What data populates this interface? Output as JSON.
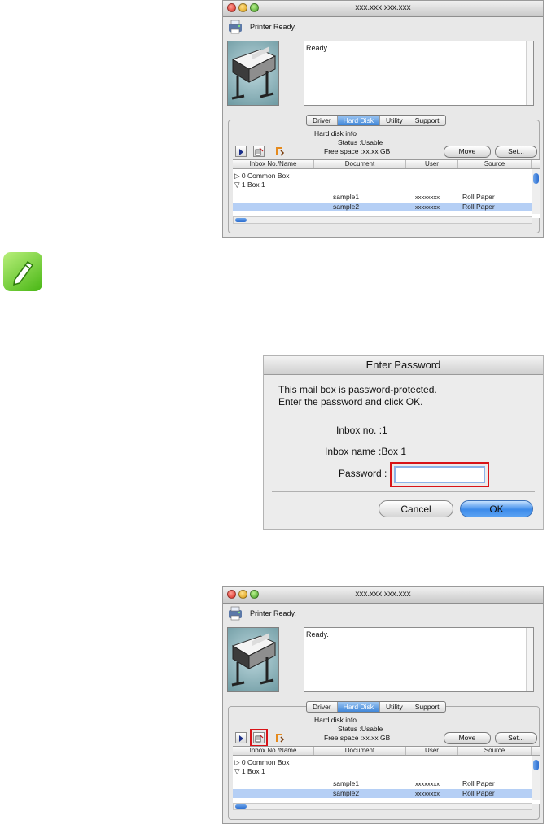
{
  "window_top": {
    "title": "xxx.xxx.xxx.xxx",
    "status": "Printer Ready.",
    "message": "Ready.",
    "tabs": [
      "Driver",
      "Hard Disk",
      "Utility",
      "Support"
    ],
    "active_tab": "Hard Disk",
    "hd_info": {
      "title": "Hard disk info",
      "status": "Status :Usable",
      "free": "Free space :xx.xx GB"
    },
    "buttons": {
      "move": "Move",
      "set": "Set..."
    },
    "columns": [
      "Inbox No./Name",
      "Document",
      "User",
      "Source"
    ],
    "rows": [
      {
        "name": "▷ 0 Common Box",
        "doc": "",
        "user": "",
        "source": ""
      },
      {
        "name": "▽ 1 Box 1",
        "doc": "",
        "user": "",
        "source": ""
      },
      {
        "name": "",
        "doc": "sample1",
        "user": "xxxxxxxx",
        "source": "Roll Paper"
      },
      {
        "name": "",
        "doc": "sample2",
        "user": "xxxxxxxx",
        "source": "Roll Paper"
      }
    ]
  },
  "dialog": {
    "title": "Enter Password",
    "line1": "This mail box is password-protected.",
    "line2": "Enter the password and click OK.",
    "inbox_no": "Inbox no. :1",
    "inbox_name": "Inbox name :Box 1",
    "password_label": "Password :",
    "password_value": "",
    "cancel": "Cancel",
    "ok": "OK"
  },
  "window_bottom": {
    "title": "xxx.xxx.xxx.xxx",
    "status": "Printer Ready.",
    "message": "Ready.",
    "tabs": [
      "Driver",
      "Hard Disk",
      "Utility",
      "Support"
    ],
    "active_tab": "Hard Disk",
    "hd_info": {
      "title": "Hard disk info",
      "status": "Status :Usable",
      "free": "Free space :xx.xx GB"
    },
    "buttons": {
      "move": "Move",
      "set": "Set..."
    },
    "columns": [
      "Inbox No./Name",
      "Document",
      "User",
      "Source"
    ],
    "rows": [
      {
        "name": "▷ 0 Common Box",
        "doc": "",
        "user": "",
        "source": ""
      },
      {
        "name": "▽ 1 Box 1",
        "doc": "",
        "user": "",
        "source": ""
      },
      {
        "name": "",
        "doc": "sample1",
        "user": "xxxxxxxx",
        "source": "Roll Paper"
      },
      {
        "name": "",
        "doc": "sample2",
        "user": "xxxxxxxx",
        "source": "Roll Paper"
      }
    ]
  },
  "colors": {
    "accent": "#3f86d8",
    "highlight_red": "#d81418",
    "selection": "#b5cff5",
    "note_green": "#48b614"
  },
  "icons": {
    "note": "pencil-note-icon",
    "status": "printer-status-icon",
    "toolbar": [
      "play-icon",
      "edit-document-icon",
      "bypass-icon"
    ]
  }
}
